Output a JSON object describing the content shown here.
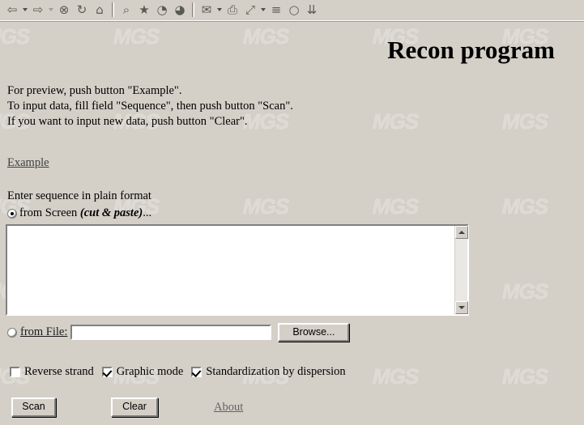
{
  "browser": {
    "toolbar": [
      {
        "name": "back-icon",
        "glyph": "⇦",
        "has_caret": true,
        "caret_dim": false
      },
      {
        "name": "forward-icon",
        "glyph": "⇨",
        "has_caret": true,
        "caret_dim": true
      },
      {
        "name": "stop-icon",
        "glyph": "⊗",
        "has_caret": false
      },
      {
        "name": "refresh-icon",
        "glyph": "↻",
        "has_caret": false
      },
      {
        "name": "home-icon",
        "glyph": "⌂",
        "has_caret": false
      },
      {
        "name": "search-icon",
        "glyph": "⌕",
        "has_caret": false
      },
      {
        "name": "favorites-folder-icon",
        "glyph": "★",
        "has_caret": false
      },
      {
        "name": "history-icon",
        "glyph": "◔",
        "has_caret": false
      },
      {
        "name": "channels-icon",
        "glyph": "◕",
        "has_caret": false
      },
      {
        "name": "mail-icon",
        "glyph": "✉",
        "has_caret": true,
        "caret_dim": false
      },
      {
        "name": "print-icon",
        "glyph": "⎙",
        "has_caret": false
      },
      {
        "name": "fullscreen-icon",
        "glyph": "⤢",
        "has_caret": true,
        "caret_dim": false
      },
      {
        "name": "edit-icon",
        "glyph": "≡",
        "has_caret": false
      },
      {
        "name": "messenger-icon",
        "glyph": "○",
        "has_caret": false
      },
      {
        "name": "download-icon",
        "glyph": "⇊",
        "has_caret": false
      }
    ]
  },
  "watermark": {
    "text": "MGS"
  },
  "page": {
    "title": "Recon program",
    "instructions": [
      "For preview, push button \"Example\".",
      "To input data, fill field \"Sequence\", then push button  \"Scan\".",
      "If  you want to input new data, push button \"Clear\"."
    ],
    "example_link": "Example",
    "enter_label": "Enter sequence in plain format",
    "source": {
      "screen_label_plain": "from Screen ",
      "screen_label_italic": "(cut & paste)",
      "screen_label_tail": "...",
      "screen_selected": true,
      "file_label": "from File:",
      "file_selected": false,
      "file_value": "",
      "file_placeholder": "",
      "browse_label": "Browse..."
    },
    "textarea": {
      "value": "",
      "placeholder": ""
    },
    "options": [
      {
        "label": "Reverse strand",
        "checked": false
      },
      {
        "label": "Graphic mode",
        "checked": true
      },
      {
        "label": "Standardization by dispersion",
        "checked": true
      }
    ],
    "actions": {
      "scan_label": "Scan",
      "clear_label": "Clear",
      "about_label": "About"
    }
  },
  "colors": {
    "background": "#d4d0c8",
    "watermark": "#dddad4",
    "field_background": "#ffffff",
    "text": "#000000",
    "link": "#3f3f3f",
    "about_link": "#636363"
  }
}
